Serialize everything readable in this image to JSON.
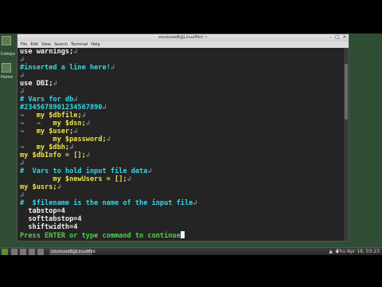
{
  "window": {
    "title": "stocksaleB@LinuxMint ~",
    "close_glyph": "✕",
    "min_glyph": "–",
    "max_glyph": "□"
  },
  "menu": [
    "File",
    "Edit",
    "View",
    "Search",
    "Terminal",
    "Help"
  ],
  "desktop": {
    "icon_labels": [
      "Compu",
      "Home"
    ]
  },
  "editor": {
    "lines": [
      [
        {
          "t": "use warnings;",
          "c": "white"
        },
        {
          "t": "↲",
          "c": "gray"
        }
      ],
      [
        {
          "t": "↲",
          "c": "gray"
        }
      ],
      [
        {
          "t": "#inserted a line here!",
          "c": "cyan"
        },
        {
          "t": "↲",
          "c": "gray"
        }
      ],
      [
        {
          "t": "↲",
          "c": "gray"
        }
      ],
      [
        {
          "t": "use DBI;",
          "c": "white"
        },
        {
          "t": "↲",
          "c": "gray"
        }
      ],
      [
        {
          "t": "↲",
          "c": "gray"
        }
      ],
      [
        {
          "t": "# Vars for db",
          "c": "cyan"
        },
        {
          "t": "↲",
          "c": "gray"
        }
      ],
      [
        {
          "t": "#2345678901234567890",
          "c": "cyan"
        },
        {
          "t": "↲",
          "c": "gray"
        }
      ],
      [
        {
          "t": "→   ",
          "c": "gray"
        },
        {
          "t": "my $dbfile;",
          "c": "yellow"
        },
        {
          "t": "↲",
          "c": "gray"
        }
      ],
      [
        {
          "t": "→   →   ",
          "c": "gray"
        },
        {
          "t": "my $dsn;",
          "c": "yellow"
        },
        {
          "t": "↲",
          "c": "gray"
        }
      ],
      [
        {
          "t": "→   ",
          "c": "gray"
        },
        {
          "t": "my $user;",
          "c": "yellow"
        },
        {
          "t": "↲",
          "c": "gray"
        }
      ],
      [
        {
          "t": "        ",
          "c": "gray"
        },
        {
          "t": "my $password;",
          "c": "yellow"
        },
        {
          "t": "↲",
          "c": "gray"
        }
      ],
      [
        {
          "t": "→   ",
          "c": "gray"
        },
        {
          "t": "my $dbh;",
          "c": "yellow"
        },
        {
          "t": "↲",
          "c": "gray"
        }
      ],
      [
        {
          "t": "my $dbInfo = [];",
          "c": "yellow"
        },
        {
          "t": "↲",
          "c": "gray"
        }
      ],
      [
        {
          "t": "↲",
          "c": "gray"
        }
      ],
      [
        {
          "t": "#  Vars to hold input file data",
          "c": "cyan"
        },
        {
          "t": "↲",
          "c": "gray"
        }
      ],
      [
        {
          "t": "        ",
          "c": "gray"
        },
        {
          "t": "my $newUsers = [];",
          "c": "yellow"
        },
        {
          "t": "↲",
          "c": "gray"
        }
      ],
      [
        {
          "t": "my $usrs;",
          "c": "yellow"
        },
        {
          "t": "↲",
          "c": "gray"
        }
      ],
      [
        {
          "t": "↲",
          "c": "gray"
        }
      ],
      [
        {
          "t": "#  $filename is the name of the input file",
          "c": "cyan"
        },
        {
          "t": "↲",
          "c": "gray"
        }
      ],
      [
        {
          "t": "  tabstop=4",
          "c": "white"
        }
      ],
      [
        {
          "t": "  softtabstop=4",
          "c": "white"
        }
      ],
      [
        {
          "t": "  shiftwidth=4",
          "c": "white"
        }
      ],
      [
        {
          "t": "Press ENTER or type command to continue",
          "c": "green"
        }
      ]
    ]
  },
  "taskbar": {
    "task_label": "stocksaleB@LinuxMint",
    "clock": "Thu Apr 16, 03:23"
  }
}
